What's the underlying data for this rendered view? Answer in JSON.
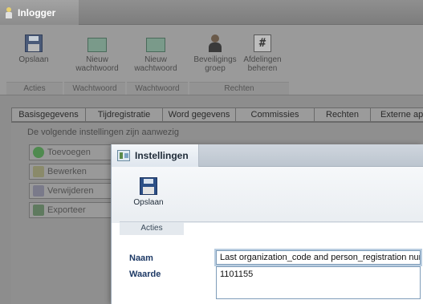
{
  "outer_window": {
    "title": "Inlogger"
  },
  "ribbon": {
    "buttons": [
      {
        "label": "Opslaan",
        "icon": "save-icon"
      },
      {
        "label": "Nieuw wachtwoord",
        "icon": "card-icon"
      },
      {
        "label": "Nieuw wachtwoord",
        "icon": "card-icon"
      },
      {
        "label": "Beveiligings groep",
        "icon": "person-icon"
      },
      {
        "label": "Afdelingen beheren",
        "icon": "hash-icon"
      }
    ],
    "groups": [
      "Acties",
      "Wachtwoord",
      "Wachtwoord",
      "Rechten"
    ]
  },
  "tabs": [
    "Basisgegevens",
    "Tijdregistratie",
    "Word gegevens",
    "Commissies",
    "Rechten",
    "Externe ap"
  ],
  "content": {
    "note": "De volgende instellingen zijn aanwezig",
    "actions": [
      "Toevoegen",
      "Bewerken",
      "Verwijderen",
      "Exporteer"
    ]
  },
  "dialog": {
    "title": "Instellingen",
    "save_label": "Opslaan",
    "group_label": "Acties",
    "naam_label": "Naam",
    "naam_value": "Last organization_code and person_registration nur",
    "waarde_label": "Waarde",
    "waarde_value": "1101155"
  },
  "colors": {
    "accent_label": "#1e3a66",
    "input_border": "#7f9db9",
    "dimmed_background": "#8d8d8d"
  }
}
